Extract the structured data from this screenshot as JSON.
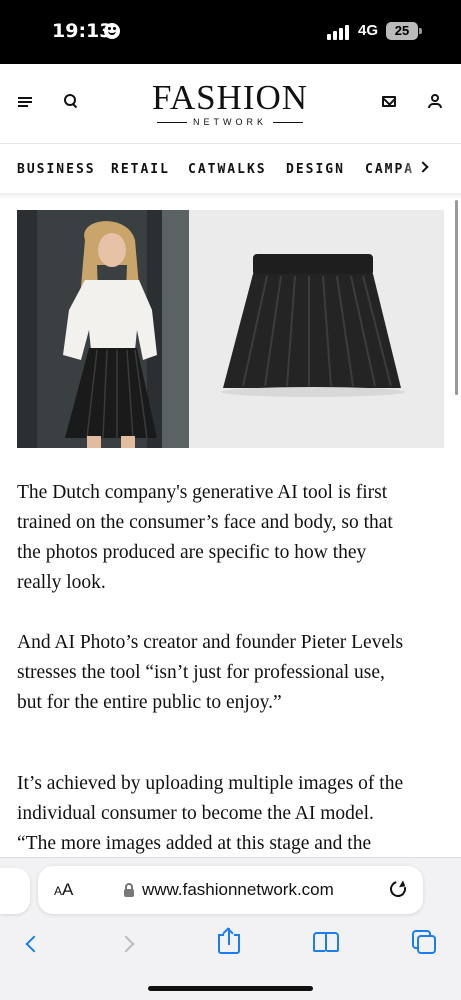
{
  "status_bar": {
    "time": "19:13",
    "network": "4G",
    "battery": "25"
  },
  "header": {
    "logo_main": "FASHION",
    "logo_sub": "NETWORK"
  },
  "nav": {
    "items": [
      "BUSINESS",
      "RETAIL",
      "CATWALKS",
      "DESIGN",
      "CAMPA"
    ]
  },
  "article": {
    "paragraphs": [
      [
        "The Dutch company's generative AI tool is first",
        "trained on the consumer’s face and body, so that",
        "the photos produced are specific to how they",
        "really look."
      ],
      [
        "And AI Photo’s creator and founder Pieter Levels",
        "stresses the tool “isn’t just for professional use,",
        "but for the entire public to enjoy.”"
      ],
      [
        "It’s achieved by uploading multiple images of the",
        "individual consumer to become the AI model.",
        "“The more images added at this stage and the"
      ]
    ]
  },
  "browser": {
    "text_size_label": "AA",
    "url": "www.fashionnetwork.com"
  },
  "colors": {
    "accent": "#1a7ef0",
    "status_bar_bg": "#000000"
  }
}
